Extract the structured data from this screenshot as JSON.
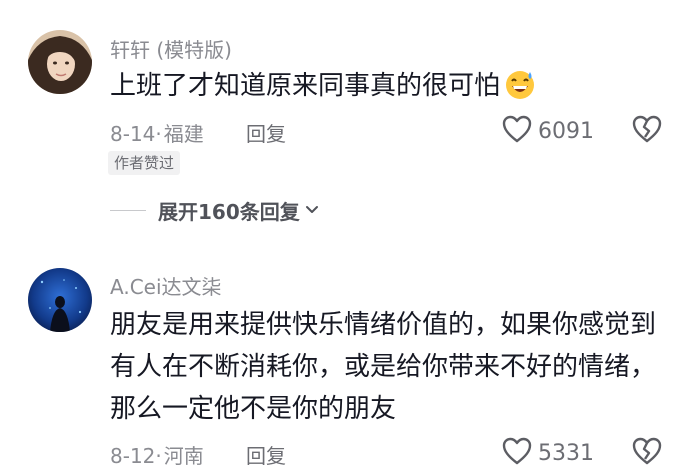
{
  "comments": [
    {
      "username": "轩轩 (模特版)",
      "content": "上班了才知道原来同事真的很可怕",
      "emoji": "grinning-sweat-face-icon",
      "date": "8-14",
      "separator": "·",
      "location": "福建",
      "reply_label": "回复",
      "likes": "6091",
      "badge": "作者赞过",
      "expand_label": "展开160条回复"
    },
    {
      "username": "A.Cei达文柒",
      "content_lines": [
        "朋友是用来提供快乐情绪价值的，如果你感觉到",
        "有人在不断消耗你，或是给你带来不好的情绪，",
        "那么一定他不是你的朋友"
      ],
      "date": "8-12",
      "separator": "·",
      "location": "河南",
      "reply_label": "回复",
      "likes": "5331"
    }
  ],
  "colors": {
    "primary_text": "#161823",
    "secondary_text": "#8a8b91",
    "badge_bg": "#f1f1f2"
  }
}
